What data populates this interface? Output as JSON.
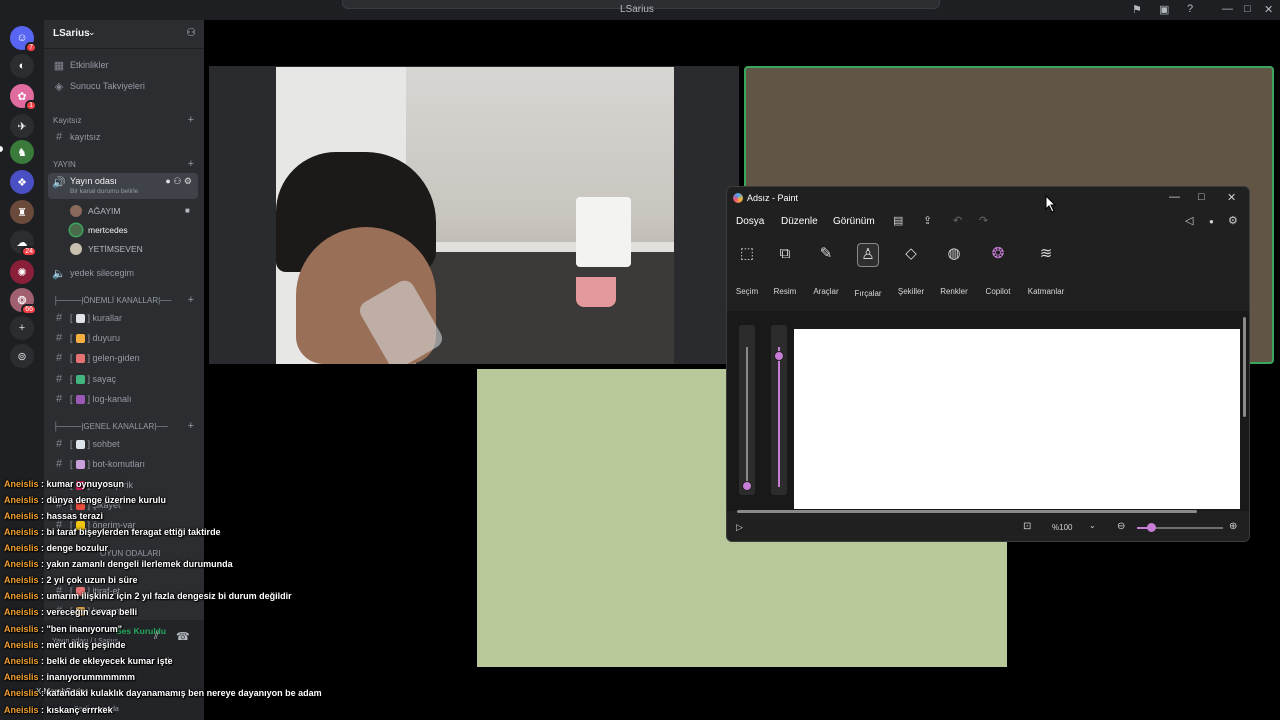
{
  "window": {
    "title": "LSarius"
  },
  "guild": {
    "name": "LSarius"
  },
  "sidebar": {
    "events": "Etkinlikler",
    "boosts": "Sunucu Takviyeleri",
    "cat_kayitsiz": "Kayıtsız",
    "ch_kayitsiz": "kayıtsız",
    "cat_yayin": "YAYIN",
    "voice_active": "Yayın odası",
    "voice_status": "Bir kanal durumu belirle",
    "voice_users": [
      "AĞAYIM",
      "mertcedes",
      "YETİMSEVEN"
    ],
    "voice_yedek": "yedek silecegim",
    "cat_onemli": "├────|ÖNEMLİ KANALLAR|──",
    "onemli": [
      "kurallar",
      "duyuru",
      "gelen-giden",
      "sayaç",
      "log-kanalı"
    ],
    "cat_genel": "├────|GENEL KANALLAR|──",
    "genel": [
      "sohbet",
      "bot-komutları",
      "özel-içerik",
      "şikayet",
      "önerim-var"
    ],
    "cat_oyun": "OYUN ODALARI",
    "oyun": [
      "itiraf-et",
      "boyamaca"
    ],
    "voice_panel_status": "Ses Kuruldu",
    "voice_panel_channel": "Yayın odası / LSarius",
    "user_name": "X.MarshSarius",
    "user_status": "Sesli aramada"
  },
  "server_badges": [
    "7",
    "1",
    "24",
    "66"
  ],
  "paint": {
    "title": "Adsız - Paint",
    "menu": [
      "Dosya",
      "Düzenle",
      "Görünüm"
    ],
    "tools": [
      "Seçim",
      "Resim",
      "Araçlar",
      "Fırçalar",
      "Şekiller",
      "Renkler",
      "Copilot",
      "Katmanlar"
    ],
    "zoom": "%100"
  },
  "chat": [
    {
      "user": "Aneislis",
      "text": "kumar oynuyosun"
    },
    {
      "user": "Aneislis",
      "text": "dünya denge üzerine kurulu"
    },
    {
      "user": "Aneislis",
      "text": "hassas terazi"
    },
    {
      "user": "Aneislis",
      "text": "bi taraf bişeylerden feragat ettiği taktirde"
    },
    {
      "user": "Aneislis",
      "text": "denge bozulur"
    },
    {
      "user": "Aneislis",
      "text": "yakın zamanlı dengeli ilerlemek durumunda"
    },
    {
      "user": "Aneislis",
      "text": "2 yıl çok uzun bi süre"
    },
    {
      "user": "Aneislis",
      "text": "umarım ilişkiniz için 2 yıl fazla dengesiz bi durum değildir"
    },
    {
      "user": "Aneislis",
      "text": "vereceğin cevap belli"
    },
    {
      "user": "Aneislis",
      "text": "\"ben inanıyorum\""
    },
    {
      "user": "Aneislis",
      "text": "mert dikiş peşinde"
    },
    {
      "user": "Aneislis",
      "text": "belki de ekleyecek kumar işte"
    },
    {
      "user": "Aneislis",
      "text": "inanıyorummmmmm"
    },
    {
      "user": "Aneislis",
      "text": "kafandaki kulaklık dayanamamış ben nereye dayanıyon be adam"
    },
    {
      "user": "Aneislis",
      "text": "kıskanç errrkek"
    }
  ],
  "colors": {
    "accent": "#c77dd6",
    "speaking": "#3ba55d",
    "chat_user": "#f0a030"
  }
}
